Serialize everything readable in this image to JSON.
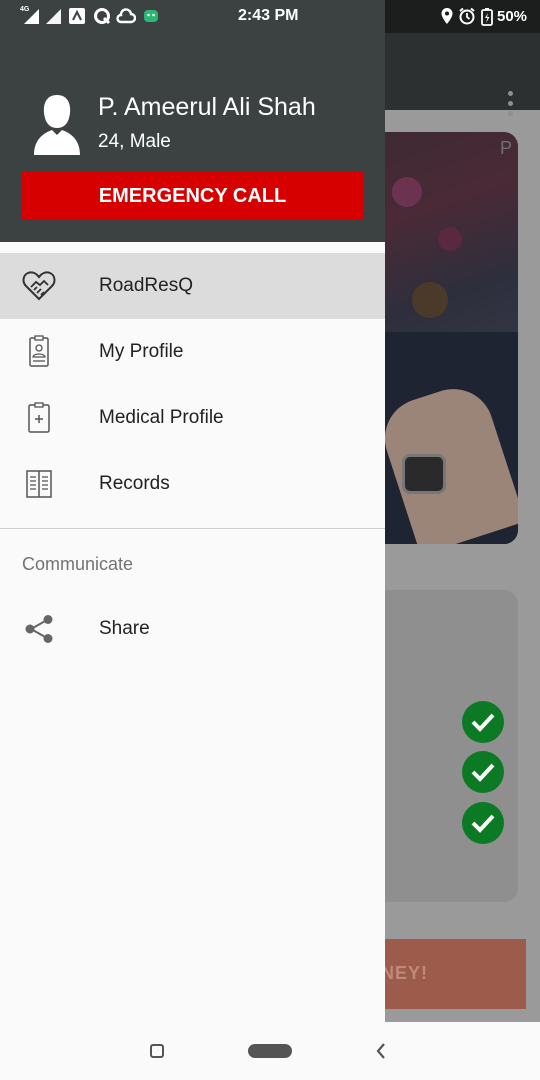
{
  "status_bar": {
    "time": "2:43 PM",
    "battery_percent": "50%",
    "network_label": "4G",
    "left_icons": [
      "signal-icon",
      "signal-icon",
      "app-notification-icon",
      "q-app-icon",
      "cloud-icon",
      "android-icon"
    ],
    "right_icons": [
      "location-icon",
      "alarm-icon",
      "battery-icon"
    ]
  },
  "drawer": {
    "user_name": "P. Ameerul Ali Shah",
    "user_meta": "24, Male",
    "emergency_label": "EMERGENCY CALL",
    "items": [
      {
        "label": "RoadResQ",
        "icon": "heart-handshake-icon",
        "active": true
      },
      {
        "label": "My Profile",
        "icon": "id-card-icon",
        "active": false
      },
      {
        "label": "Medical Profile",
        "icon": "medical-clipboard-icon",
        "active": false
      },
      {
        "label": "Records",
        "icon": "records-book-icon",
        "active": false
      }
    ],
    "section_title": "Communicate",
    "share_label": "Share",
    "share_icon": "share-icon"
  },
  "background_app": {
    "hero_corner_text": "P",
    "cta_label": "NEY!"
  },
  "colors": {
    "drawer_header": "#3c4242",
    "emergency": "#d60000",
    "active_item": "#dcdcdc",
    "check_green": "#0c7a24"
  }
}
